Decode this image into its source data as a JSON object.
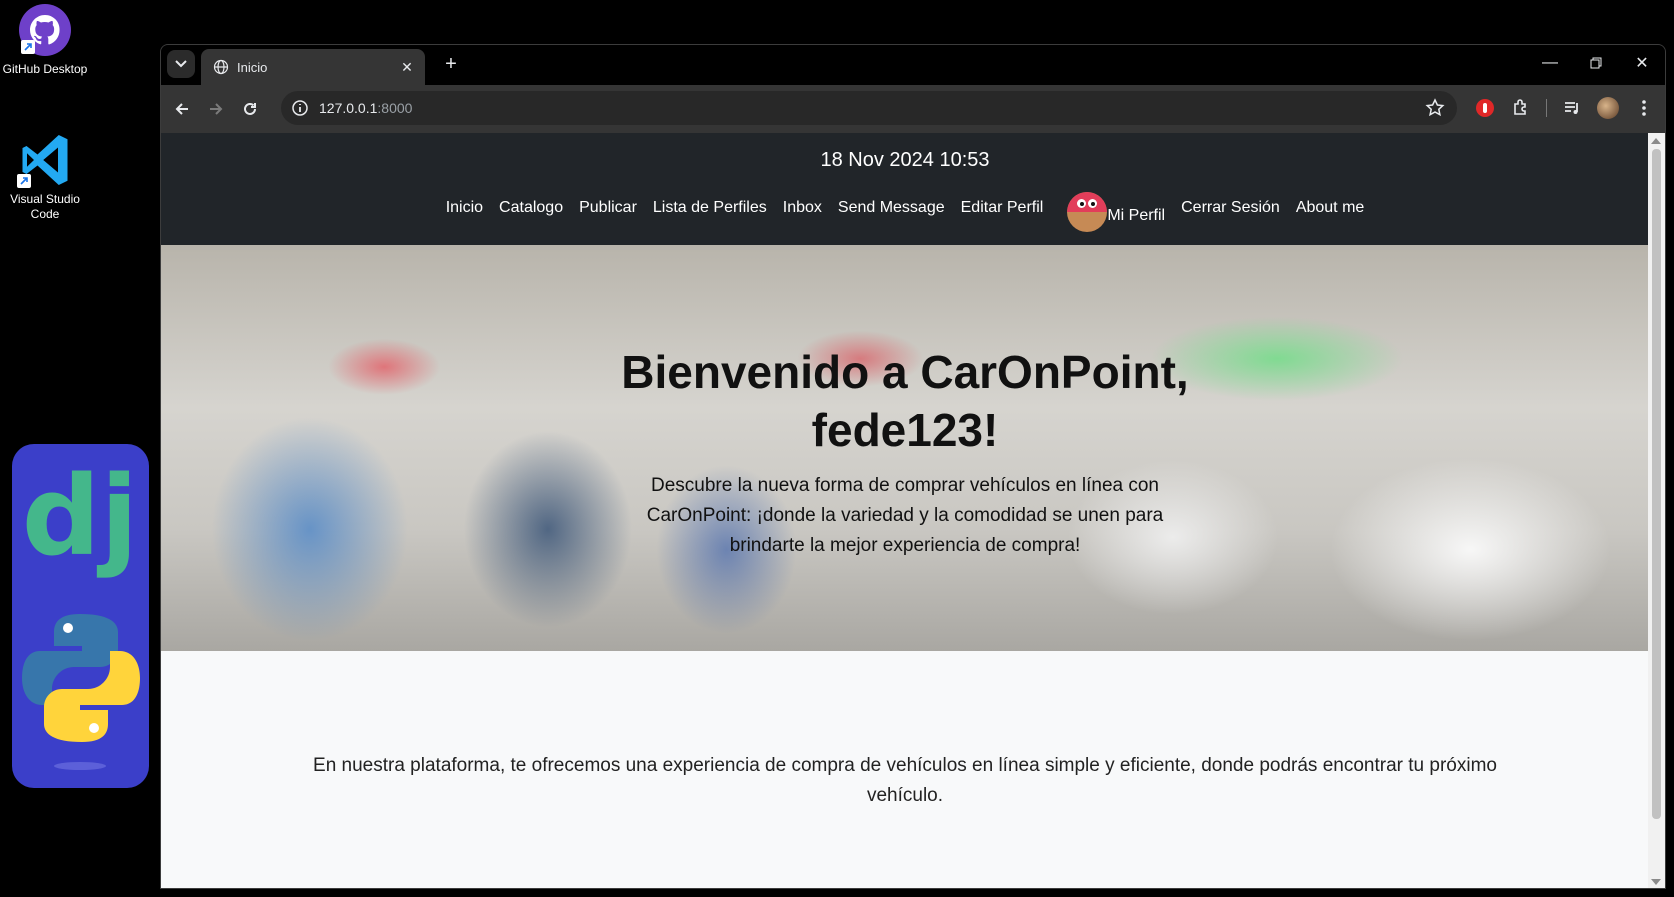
{
  "desktop": {
    "icons": [
      {
        "label": "GitHub Desktop"
      },
      {
        "label": "Visual Studio Code"
      }
    ]
  },
  "browser": {
    "tab_title": "Inicio",
    "url_host": "127.0.0.1",
    "url_port": ":8000"
  },
  "site": {
    "datetime": "18 Nov 2024 10:53",
    "nav": {
      "inicio": "Inicio",
      "catalogo": "Catalogo",
      "publicar": "Publicar",
      "lista_perfiles": "Lista de Perfiles",
      "inbox": "Inbox",
      "send_message": "Send Message",
      "editar_perfil": "Editar Perfil",
      "mi_perfil": "Mi Perfil",
      "cerrar_sesion": "Cerrar Sesión",
      "about_me": "About me"
    },
    "hero": {
      "title_line1": "Bienvenido a CarOnPoint,",
      "title_line2": "fede123!",
      "subtitle": "Descubre la nueva forma de comprar vehículos en línea con CarOnPoint: ¡donde la variedad y la comodidad se unen para brindarte la mejor experiencia de compra!"
    },
    "intro": "En nuestra plataforma, te ofrecemos una experiencia de compra de vehículos en línea simple y eficiente, donde podrás encontrar tu próximo vehículo."
  },
  "colors": {
    "navbar_bg": "#212529",
    "page_bg": "#f8f9fa",
    "tile_bg": "#3b3fc9"
  }
}
